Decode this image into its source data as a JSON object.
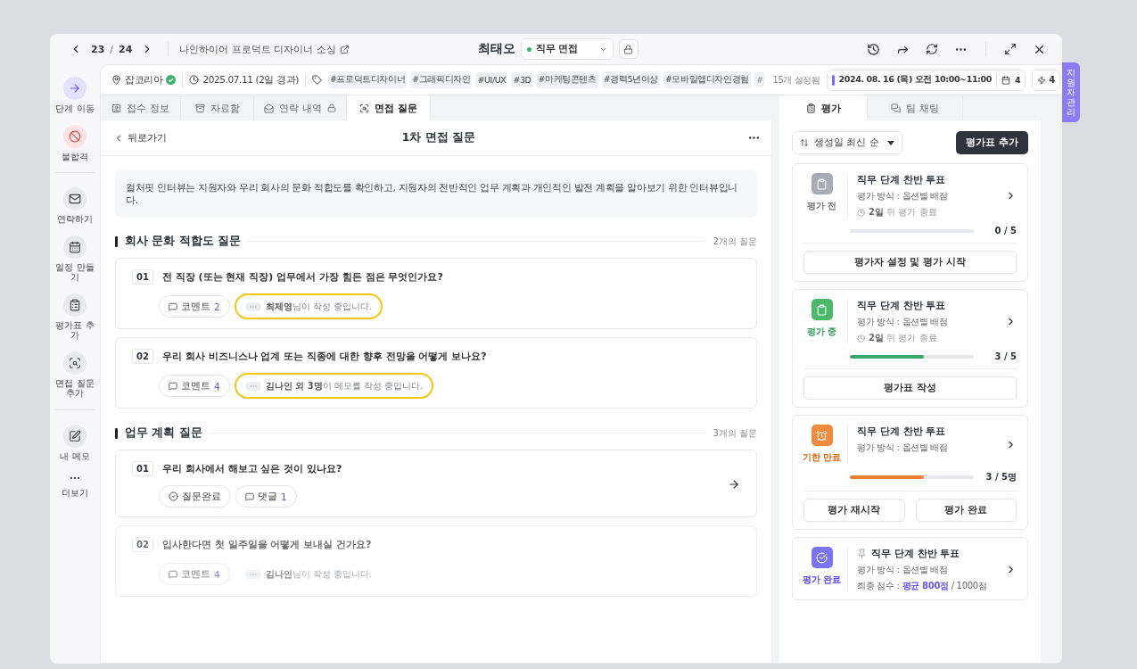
{
  "nav": {
    "page_current": "23",
    "page_separator": "/",
    "page_total": "24",
    "job_title": "나인하이어 프로덕트 디자이너 소싱",
    "candidate": "최태오",
    "stage": "직무 면접",
    "locked": true
  },
  "info_bar": {
    "source": "잡코리아",
    "verified": true,
    "applied": "2025.07.11 (2일 경과)",
    "tags": [
      {
        "label": "#프로덕트디자이너",
        "faded": false
      },
      {
        "label": "#그래픽디자인",
        "faded": false
      },
      {
        "label": "#UI/UX",
        "faded": false
      },
      {
        "label": "#3D",
        "faded": false
      },
      {
        "label": "#마케팅콘텐츠",
        "faded": false
      },
      {
        "label": "#경력5년이상",
        "faded": false
      },
      {
        "label": "#모바일앱디자인경험",
        "faded": false
      },
      {
        "label": "#",
        "faded": true
      }
    ],
    "tag_count": "15개 설정됨",
    "schedule": "2024. 08. 16 (목) 오전 10:00~11:00",
    "schedule_count": "4",
    "bolt_count": "4"
  },
  "side_tab": "지원자 관리",
  "sidebar": [
    [
      {
        "label": "단계 이동",
        "kind": "primary"
      },
      {
        "label": "불합격",
        "kind": "danger"
      }
    ],
    [
      {
        "label": "연락하기",
        "kind": "default"
      },
      {
        "label": "일정 만들기",
        "kind": "default"
      },
      {
        "label": "평가표 추가",
        "kind": "default"
      },
      {
        "label": "면접 질문 추가",
        "kind": "default"
      }
    ],
    [
      {
        "label": "내 메모",
        "kind": "default"
      },
      {
        "label": "더보기",
        "kind": "more"
      }
    ]
  ],
  "tabs": [
    {
      "label": "접수 정보",
      "selected": false,
      "locked": false
    },
    {
      "label": "자료함",
      "selected": false,
      "locked": false
    },
    {
      "label": "연락 내역",
      "selected": false,
      "locked": true
    },
    {
      "label": "면접 질문",
      "selected": true,
      "locked": false
    }
  ],
  "questions_page": {
    "back": "뒤로가기",
    "title": "1차 면접 질문",
    "intro": "컬처핏 인터뷰는 지원자와 우리 회사의 문화 적합도를 확인하고, 지원자의 전반적인 업무 계획과 개인적인 발전 계획을 알아보기 위한 인터뷰입니다.",
    "sections": [
      {
        "title": "회사 문화 적합도 질문",
        "count": "2개의 질문",
        "questions": [
          {
            "number": "01",
            "text": "전 직장 (또는 현재 직장) 업무에서 가장 힘든 점은 무엇인가요?",
            "faded": false,
            "linked": false,
            "chips": [
              {
                "kind": "comment",
                "label": "코멘트",
                "count": "2"
              }
            ],
            "typing": {
              "text": "**최제영**님이 작성 중입니다.",
              "highlighted": true
            }
          },
          {
            "number": "02",
            "text": "우리 회사 비즈니스나 업계 또는 직종에 대한 향후 전망을 어떻게 보나요?",
            "faded": false,
            "linked": false,
            "chips": [
              {
                "kind": "comment",
                "label": "코멘트",
                "count": "4"
              }
            ],
            "typing": {
              "text": "**김나인 외 3명**이 메모를 작성 중입니다.",
              "highlighted": true
            }
          }
        ]
      },
      {
        "title": "업무 계획 질문",
        "count": "3개의 질문",
        "questions": [
          {
            "number": "01",
            "text": "우리 회사에서 해보고 싶은 것이 있나요?",
            "faded": false,
            "linked": true,
            "chips": [
              {
                "kind": "done",
                "label": "질문완료"
              },
              {
                "kind": "comment",
                "label": "댓글",
                "count": "1"
              }
            ]
          },
          {
            "number": "02",
            "text": "입사한다면 첫 일주일을 어떻게 보내실 건가요?",
            "faded": true,
            "linked": false,
            "chips": [
              {
                "kind": "comment",
                "label": "코멘트",
                "count": "4"
              }
            ],
            "typing": {
              "text": "**김나인**님이 작성 중입니다.",
              "highlighted": false
            }
          }
        ]
      }
    ]
  },
  "right_tabs": [
    {
      "label": "평가",
      "selected": true
    },
    {
      "label": "팀 채팅",
      "selected": false
    }
  ],
  "sort": "생성일 최신 순",
  "add_button": "평가표 추가",
  "evaluations": [
    {
      "kind": "before",
      "status_label": "평가 전",
      "pinned": false,
      "title": "직무 단계 찬반 투표",
      "method": "평가 방식 : 옵션별 배점",
      "deadline": "**2일** 뒤 평가 종료",
      "level": 0,
      "progress": "0 / 5",
      "actions": [
        "평가자 설정 및 평가 시작"
      ]
    },
    {
      "kind": "progress",
      "status_label": "평가 중",
      "pinned": false,
      "title": "직무 단계 찬반 투표",
      "method": "평가 방식 : 옵션별 배점",
      "deadline": "**2일** 뒤 평가 종료",
      "level": 0.6,
      "progress": "3 / 5",
      "actions": [
        "평가표 작성"
      ]
    },
    {
      "kind": "overdue",
      "status_label": "기한 만료",
      "pinned": false,
      "title": "직무 단계 찬반 투표",
      "method": "평가 방식 : 옵션별 배점",
      "level": 0.6,
      "progress": "3 / 5명",
      "actions": [
        "평가 재시작",
        "평가 완료"
      ]
    },
    {
      "kind": "done",
      "status_label": "평가 완료",
      "pinned": true,
      "title": "직무 단계 찬반 투표",
      "method": "평가 방식 : 옵션별 배점",
      "score": "최종 점수 : **평균 800점** / 1000점"
    }
  ]
}
